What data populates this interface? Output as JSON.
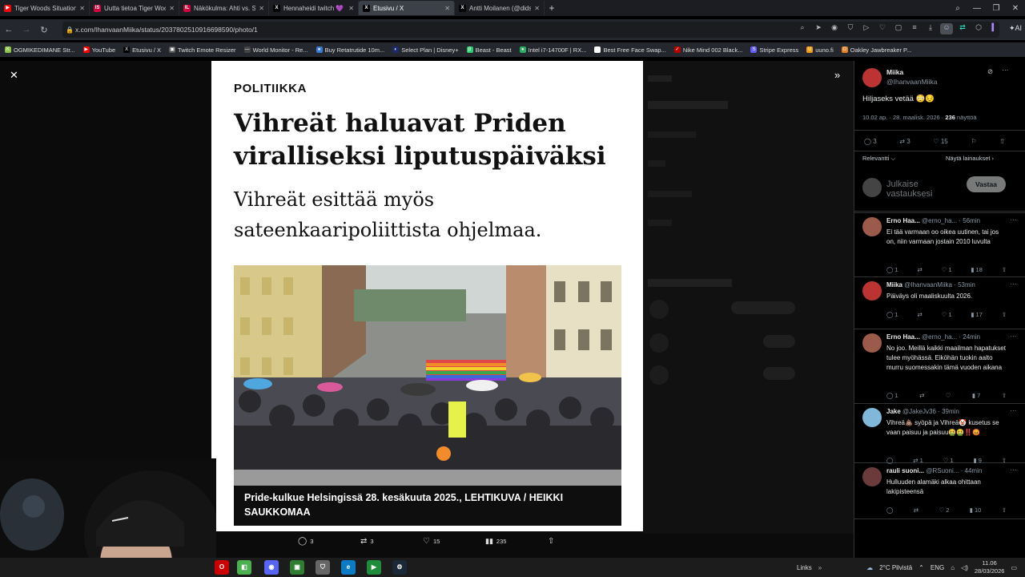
{
  "browser": {
    "tabs": [
      {
        "label": "Tiger Woods Situation - Yo",
        "color": "#ff0000",
        "glyph": "▶"
      },
      {
        "label": "Uutta tietoa Tiger Woodsi",
        "color": "#d4003c",
        "glyph": "IS"
      },
      {
        "label": "Näkökulma: Ahti vs. Sann",
        "color": "#d4003c",
        "glyph": "IL"
      },
      {
        "label": "Hennaheidi twitch 💜 (@",
        "color": "#000000",
        "glyph": "X"
      },
      {
        "label": "Etusivu / X",
        "color": "#000000",
        "glyph": "X"
      },
      {
        "label": "Antti Moilanen (@didskti",
        "color": "#000000",
        "glyph": "X"
      }
    ],
    "active_tab_index": 4,
    "url": "x.com/IhanvaanMiika/status/2037802510916698590/photo/1",
    "ai_label": "AI",
    "bookmarks": [
      {
        "label": "OGMIKEDIMANE Str...",
        "color": "#8bc34a",
        "glyph": "K"
      },
      {
        "label": "YouTube",
        "color": "#ff0000",
        "glyph": "▶"
      },
      {
        "label": "Etusivu / X",
        "color": "#000000",
        "glyph": "X"
      },
      {
        "label": "Twitch Emote Resizer",
        "color": "#555555",
        "glyph": "▣"
      },
      {
        "label": "World Monitor - Re...",
        "color": "#444444",
        "glyph": "—"
      },
      {
        "label": "Buy Retatrutide 10m...",
        "color": "#3a7bd5",
        "glyph": "●"
      },
      {
        "label": "Select Plan | Disney+",
        "color": "#1a2a6c",
        "glyph": "◐"
      },
      {
        "label": "Beast - Beast",
        "color": "#2ecc71",
        "glyph": "β"
      },
      {
        "label": "Intel i7-14700F | RX...",
        "color": "#27ae60",
        "glyph": "●"
      },
      {
        "label": "Best Free Face Swap...",
        "color": "#ffffff",
        "glyph": "▣"
      },
      {
        "label": "Nike Mind 002 Black...",
        "color": "#b00",
        "glyph": "✓"
      },
      {
        "label": "Stripe Express",
        "color": "#635bff",
        "glyph": "S"
      },
      {
        "label": "uuno.fi",
        "color": "#f39c12",
        "glyph": "U"
      },
      {
        "label": "Oakley Jawbreaker P...",
        "color": "#e67e22",
        "glyph": "O"
      }
    ]
  },
  "article": {
    "kicker": "POLITIIKKA",
    "headline": "Vihreät haluavat Priden viralliseksi liputuspäiväksi",
    "subheadline": "Vihreät esittää myös sateenkaaripoliittista ohjelmaa.",
    "caption": "Pride-kulkue Helsingissä 28. kesäkuuta 2025., LEHTIKUVA / HEIKKI SAUKKOMAA"
  },
  "photo_actions": {
    "replies": "3",
    "reposts": "3",
    "likes": "15",
    "views": "235"
  },
  "post": {
    "author": "Miika",
    "handle": "@IhanvaanMiika",
    "text": "Hiljaseks vetää 😳😔",
    "time": "10.02 ap. · 28. maalisk. 2026 · ",
    "views_count": "236",
    "views_label": " näyttöä",
    "replies": "3",
    "reposts": "3",
    "likes": "15",
    "sort_label": "Relevantti",
    "quotes_label": "Näytä lainaukset"
  },
  "composer": {
    "placeholder": "Julkaise vastauksesi",
    "reply_button": "Vastaa"
  },
  "replies": [
    {
      "author": "Erno Haa...",
      "handle": "@erno_ha...",
      "time": "· 56min",
      "text": "Ei tää varmaan oo oikea uutinen, tai jos on, niin varmaan jostain 2010 luvulta",
      "r": "1",
      "rt": "",
      "l": "1",
      "v": "18",
      "avatar": "#9c5a4a"
    },
    {
      "author": "Miika",
      "handle": "@IhanvaanMiika",
      "time": "· 53min",
      "text": "Päiväys oli maaliskuulta 2026.",
      "r": "1",
      "rt": "",
      "l": "1",
      "v": "17",
      "avatar": "#b33"
    },
    {
      "author": "Erno Haa...",
      "handle": "@erno_ha...",
      "time": "· 24min",
      "text": "No joo. Meillä kaikki maailman hapatukset tulee myöhässä. Eiköhän tuokin aalto murru suomessakin tämä vuoden aikana",
      "r": "1",
      "rt": "",
      "l": "",
      "v": "7",
      "avatar": "#9c5a4a"
    },
    {
      "author": "Jake",
      "handle": "@JakeJv36",
      "time": "· 39min",
      "text": "Vihreä💩 syöpä ja Vihreä🤡 kusetus se vaan paisuu ja paisuu🤮🤮‼️😡",
      "r": "",
      "rt": "1",
      "l": "1",
      "v": "9",
      "avatar": "#7fb8d8"
    },
    {
      "author": "rauli suoni...",
      "handle": "@RSuoni...",
      "time": "· 44min",
      "text": "Hulluuden alamäki alkaa ohittaan lakipisteensä",
      "r": "",
      "rt": "",
      "l": "2",
      "v": "10",
      "avatar": "#6b3b3b"
    }
  ],
  "taskbar": {
    "links_label": "Links",
    "weather": "2°C  Pilvistä",
    "lang": "ENG",
    "time": "11.06",
    "date": "28/03/2026"
  }
}
